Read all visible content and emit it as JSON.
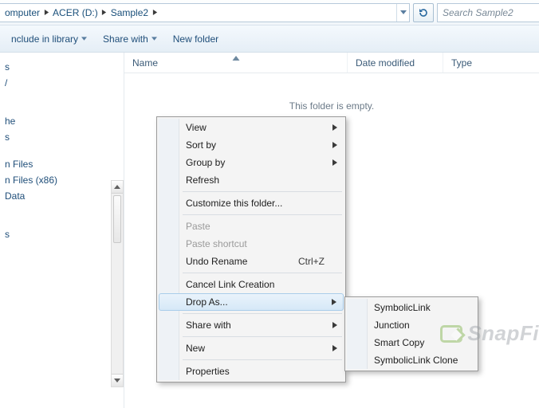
{
  "breadcrumb": {
    "items": [
      "omputer",
      "ACER (D:)",
      "Sample2"
    ]
  },
  "search": {
    "placeholder": "Search Sample2"
  },
  "toolbar": {
    "include": "nclude in library",
    "share": "Share with",
    "newfolder": "New folder"
  },
  "nav": {
    "items_top": [
      "s",
      "/"
    ],
    "items_mid": [
      "he",
      "s"
    ],
    "items_bot": [
      "n Files",
      "n Files (x86)",
      "Data"
    ],
    "items_last": [
      "s"
    ]
  },
  "columns": {
    "name": "Name",
    "date": "Date modified",
    "type": "Type"
  },
  "empty_text": "This folder is empty.",
  "ctx": {
    "view": "View",
    "sortby": "Sort by",
    "groupby": "Group by",
    "refresh": "Refresh",
    "customize": "Customize this folder...",
    "paste": "Paste",
    "paste_shortcut": "Paste shortcut",
    "undo": "Undo Rename",
    "undo_sc": "Ctrl+Z",
    "cancel_link": "Cancel Link Creation",
    "drop_as": "Drop As...",
    "share_with": "Share with",
    "new": "New",
    "properties": "Properties"
  },
  "dropas": {
    "sym": "SymbolicLink",
    "junc": "Junction",
    "smart": "Smart Copy",
    "clone": "SymbolicLink Clone"
  },
  "watermark": "SnapFi"
}
